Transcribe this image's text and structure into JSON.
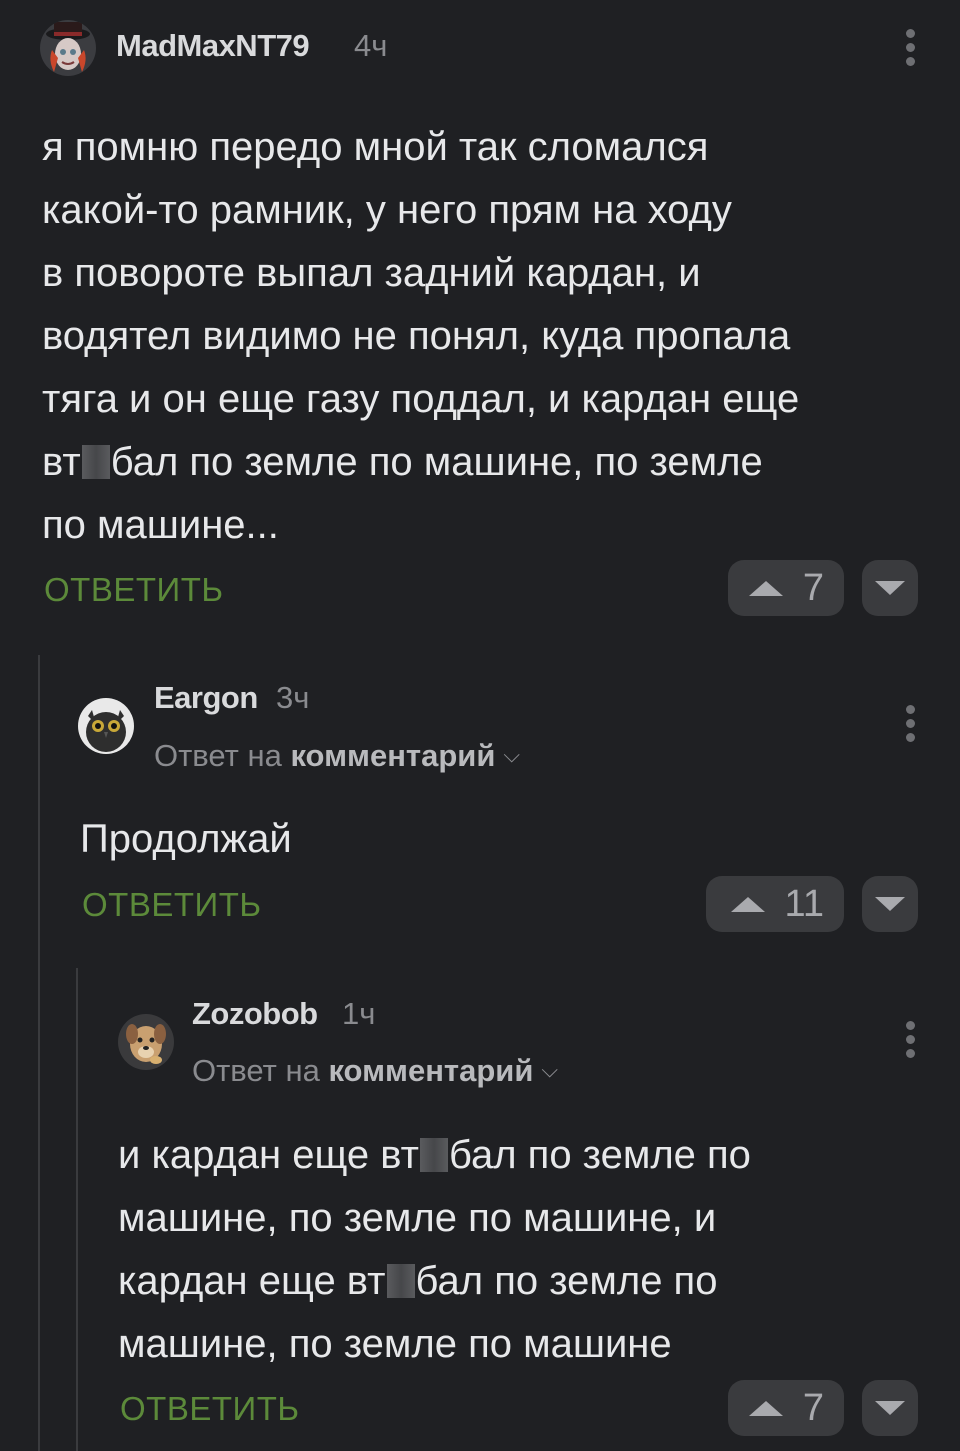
{
  "comments": [
    {
      "author": "MadMaxNT79",
      "time": "4ч",
      "lines": [
        "я помню передо мной так сломался",
        "какой-то рамник, у него прям на ходу",
        "в повороте выпал задний кардан, и",
        "водятел видимо не понял, куда пропала",
        "тяга и он еще газу поддал, и кардан еще",
        [
          "вт",
          "бал по земле по машине, по земле"
        ],
        "по машине..."
      ],
      "reply_label": "ОТВЕТИТЬ",
      "votes": "7"
    },
    {
      "author": "Eargon",
      "time": "3ч",
      "reply_prefix": "Ответ на",
      "reply_target": "комментарий",
      "lines": [
        "Продолжай"
      ],
      "reply_label": "ОТВЕТИТЬ",
      "votes": "11"
    },
    {
      "author": "Zozobob",
      "time": "1ч",
      "reply_prefix": "Ответ на",
      "reply_target": "комментарий",
      "lines": [
        [
          "и кардан еще вт",
          "бал по земле по"
        ],
        "машине, по земле по машине, и",
        [
          "кардан еще вт",
          "бал по земле по"
        ],
        "машине, по земле по машине"
      ],
      "reply_label": "ОТВЕТИТЬ",
      "votes": "7"
    }
  ],
  "colors": {
    "background": "#1f2023",
    "reply_green": "#5c8a3a",
    "vote_bg": "#3a3b3e"
  },
  "icons": [
    "avatar-madmax",
    "avatar-owl",
    "avatar-dog",
    "kebab-menu-icon",
    "upvote-icon",
    "downvote-icon",
    "chevron-down-icon"
  ]
}
